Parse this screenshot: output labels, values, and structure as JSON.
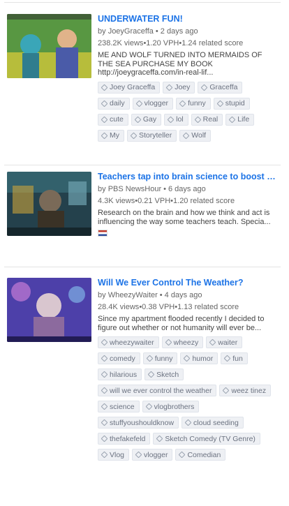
{
  "feed": {
    "videos": [
      {
        "title": "UNDERWATER FUN!",
        "channel": "JoeyGraceffa",
        "age": "2 days ago",
        "views": "238.2K views",
        "vph": "1.20 VPH",
        "score": "1.24 related score",
        "description": "ME AND WOLF TURNED INTO MERMAIDS OF THE SEA PURCHASE MY BOOK http://joeygraceffa.com/in-real-lif...",
        "flag": "",
        "tags": [
          "Joey Graceffa",
          "Joey",
          "Graceffa",
          "daily",
          "vlogger",
          "funny",
          "stupid",
          "cute",
          "Gay",
          "lol",
          "Real",
          "Life",
          "My",
          "Storyteller",
          "Wolf"
        ],
        "thumb_colors": {
          "bg": "#5a8f3a",
          "accent": "#d7c93a",
          "figure": "#e0b38a"
        }
      },
      {
        "title": "Teachers tap into brain science to boost learning",
        "channel": "PBS NewsHour",
        "age": "6 days ago",
        "views": "4.3K views",
        "vph": "0.21 VPH",
        "score": "1.20 related score",
        "description": "Research on the brain and how we think and act is influencing the way some teachers teach. Specia...",
        "flag": "us-flag",
        "tags": [],
        "thumb_colors": {
          "bg": "#2c4a55",
          "accent": "#c9a23b",
          "figure": "#7a6a58"
        }
      },
      {
        "title": "Will We Ever Control The Weather?",
        "channel": "WheezyWaiter",
        "age": "4 days ago",
        "views": "28.4K views",
        "vph": "0.38 VPH",
        "score": "1.13 related score",
        "description": "Since my apartment flooded recently I decided to figure out whether or not humanity will ever be...",
        "flag": "",
        "tags": [
          "wheezywaiter",
          "wheezy",
          "waiter",
          "comedy",
          "funny",
          "humor",
          "fun",
          "hilarious",
          "Sketch",
          "will we ever control the weather",
          "weez tinez",
          "science",
          "vlogbrothers",
          "stuffyoushouldknow",
          "cloud seeding",
          "thefakefeld",
          "Sketch Comedy (TV Genre)",
          "Vlog",
          "vlogger",
          "Comedian"
        ],
        "thumb_colors": {
          "bg": "#4a3f9c",
          "accent": "#c47ad6",
          "figure": "#d9c6cf"
        }
      }
    ]
  }
}
